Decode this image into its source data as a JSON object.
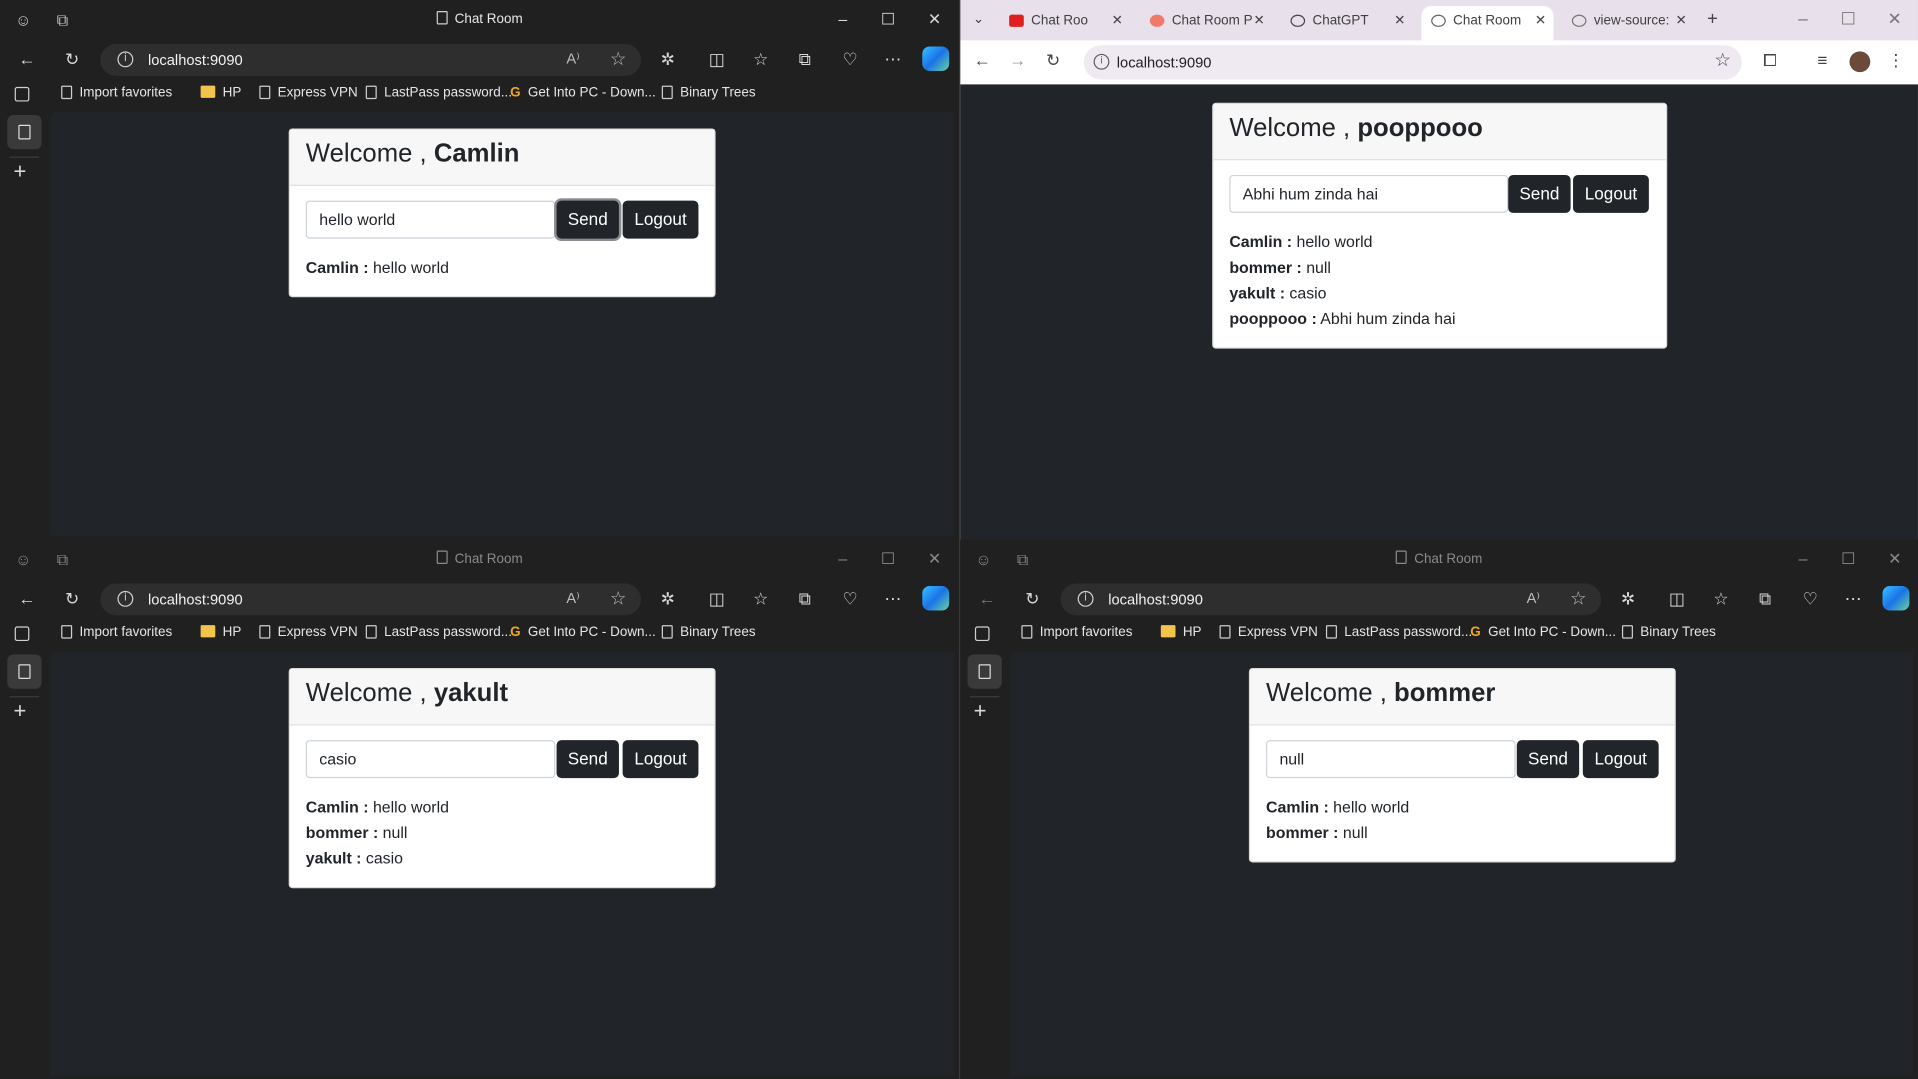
{
  "edge_common": {
    "address": "localhost:9090",
    "read_aloud": "A⁾",
    "favorites": [
      "Import favorites",
      "HP",
      "Express VPN",
      "LastPass password...",
      "Get Into PC - Down...",
      "Binary Trees"
    ]
  },
  "windows": {
    "top_left": {
      "title": "Chat Room",
      "username": "Camlin",
      "input": "hello world",
      "messages": [
        {
          "user": "Camlin :",
          "text": " hello world"
        }
      ]
    },
    "bottom_left": {
      "title": "Chat Room",
      "username": "yakult",
      "input": "casio",
      "messages": [
        {
          "user": "Camlin :",
          "text": " hello world"
        },
        {
          "user": "bommer :",
          "text": " null"
        },
        {
          "user": "yakult :",
          "text": " casio"
        }
      ]
    },
    "bottom_right": {
      "title": "Chat Room",
      "username": "bommer",
      "input": "null",
      "messages": [
        {
          "user": "Camlin :",
          "text": " hello world"
        },
        {
          "user": "bommer :",
          "text": " null"
        }
      ]
    },
    "top_right": {
      "address": "localhost:9090",
      "username": "pooppooo",
      "input": "Abhi hum zinda hai",
      "tabs": [
        "Chat Roo",
        "Chat Room P",
        "ChatGPT",
        "Chat Room",
        "view-source:"
      ],
      "messages": [
        {
          "user": "Camlin :",
          "text": " hello world"
        },
        {
          "user": "bommer :",
          "text": " null"
        },
        {
          "user": "yakult :",
          "text": " casio"
        },
        {
          "user": "pooppooo :",
          "text": " Abhi hum zinda hai"
        }
      ]
    }
  },
  "labels": {
    "welcome": "Welcome , ",
    "send": "Send",
    "logout": "Logout"
  }
}
